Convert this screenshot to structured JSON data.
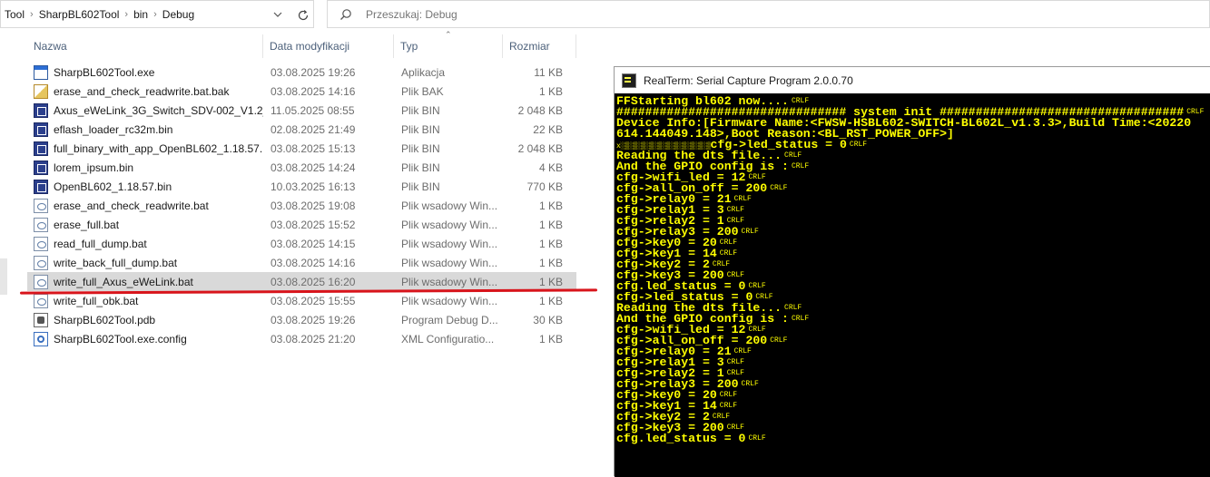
{
  "explorer": {
    "breadcrumb": [
      "Tool",
      "SharpBL602Tool",
      "bin",
      "Debug"
    ],
    "breadcrumb_sep": "›",
    "search_placeholder": "Przeszukaj: Debug",
    "columns": {
      "name": "Nazwa",
      "date": "Data modyfikacji",
      "type": "Typ",
      "size": "Rozmiar"
    },
    "files": [
      {
        "name": "SharpBL602Tool.exe",
        "date": "03.08.2025 19:26",
        "type": "Aplikacja",
        "size": "11 KB",
        "icon": "exe-icon"
      },
      {
        "name": "erase_and_check_readwrite.bat.bak",
        "date": "03.08.2025 14:16",
        "type": "Plik BAK",
        "size": "1 KB",
        "icon": "bak-icon"
      },
      {
        "name": "Axus_eWeLink_3G_Switch_SDV-002_V1.2_...",
        "date": "11.05.2025 08:55",
        "type": "Plik BIN",
        "size": "2 048 KB",
        "icon": "bin-icon"
      },
      {
        "name": "eflash_loader_rc32m.bin",
        "date": "02.08.2025 21:49",
        "type": "Plik BIN",
        "size": "22 KB",
        "icon": "bin-icon"
      },
      {
        "name": "full_binary_with_app_OpenBL602_1.18.57....",
        "date": "03.08.2025 15:13",
        "type": "Plik BIN",
        "size": "2 048 KB",
        "icon": "bin-icon"
      },
      {
        "name": "lorem_ipsum.bin",
        "date": "03.08.2025 14:24",
        "type": "Plik BIN",
        "size": "4 KB",
        "icon": "bin-icon"
      },
      {
        "name": "OpenBL602_1.18.57.bin",
        "date": "10.03.2025 16:13",
        "type": "Plik BIN",
        "size": "770 KB",
        "icon": "bin-icon"
      },
      {
        "name": "erase_and_check_readwrite.bat",
        "date": "03.08.2025 19:08",
        "type": "Plik wsadowy Win...",
        "size": "1 KB",
        "icon": "bat-icon"
      },
      {
        "name": "erase_full.bat",
        "date": "03.08.2025 15:52",
        "type": "Plik wsadowy Win...",
        "size": "1 KB",
        "icon": "bat-icon"
      },
      {
        "name": "read_full_dump.bat",
        "date": "03.08.2025 14:15",
        "type": "Plik wsadowy Win...",
        "size": "1 KB",
        "icon": "bat-icon"
      },
      {
        "name": "write_back_full_dump.bat",
        "date": "03.08.2025 14:16",
        "type": "Plik wsadowy Win...",
        "size": "1 KB",
        "icon": "bat-icon"
      },
      {
        "name": "write_full_Axus_eWeLink.bat",
        "date": "03.08.2025 16:20",
        "type": "Plik wsadowy Win...",
        "size": "1 KB",
        "icon": "bat-icon",
        "selected": true
      },
      {
        "name": "write_full_obk.bat",
        "date": "03.08.2025 15:55",
        "type": "Plik wsadowy Win...",
        "size": "1 KB",
        "icon": "bat-icon"
      },
      {
        "name": "SharpBL602Tool.pdb",
        "date": "03.08.2025 19:26",
        "type": "Program Debug D...",
        "size": "30 KB",
        "icon": "pdb-icon"
      },
      {
        "name": "SharpBL602Tool.exe.config",
        "date": "03.08.2025 21:20",
        "type": "XML Configuratio...",
        "size": "1 KB",
        "icon": "config-icon"
      }
    ],
    "annotation_color": "#d8141b"
  },
  "realterm": {
    "title": "RealTerm: Serial Capture Program 2.0.0.70",
    "text_color": "#ffff00",
    "background": "#000000",
    "crlf_marker": "CRLF",
    "lines": [
      "FFStarting bl602 now....",
      "################################ system init ##################################",
      "Device Info:[Firmware Name:<FWSW-HSBL602-SWITCH-BL602L_v1.3.3>,Build Time:<20220",
      "614.144049.148>,Boot Reason:<BL_RST_POWER_OFF>]",
      "cfg->led_status = 0",
      "Reading the dts file...",
      "And the GPIO config is :",
      "cfg->wifi_led = 12",
      "cfg->all_on_off = 200",
      "cfg->relay0 = 21",
      "cfg->relay1 = 3",
      "cfg->relay2 = 1",
      "cfg->relay3 = 200",
      "cfg->key0 = 20",
      "cfg->key1 = 14",
      "cfg->key2 = 2",
      "cfg->key3 = 200",
      "cfg.led_status = 0",
      "cfg->led_status = 0",
      "Reading the dts file...",
      "And the GPIO config is :",
      "cfg->wifi_led = 12",
      "cfg->all_on_off = 200",
      "cfg->relay0 = 21",
      "cfg->relay1 = 3",
      "cfg->relay2 = 1",
      "cfg->relay3 = 200",
      "cfg->key0 = 20",
      "cfg->key1 = 14",
      "cfg->key2 = 2",
      "cfg->key3 = 200",
      "cfg.led_status = 0"
    ]
  }
}
